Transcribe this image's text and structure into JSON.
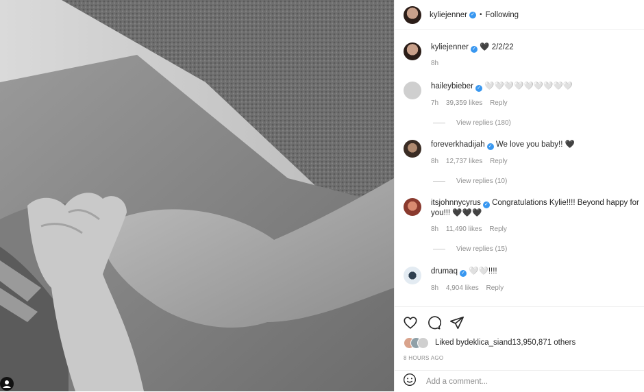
{
  "header": {
    "username": "kyliejenner",
    "separator": "•",
    "follow_status": "Following"
  },
  "caption": {
    "username": "kyliejenner",
    "text": "🖤 2/2/22",
    "time": "8h"
  },
  "comments": [
    {
      "username": "haileybieber",
      "text": "🤍🤍🤍🤍🤍🤍🤍🤍🤍",
      "time": "7h",
      "likes": "39,359 likes",
      "reply": "Reply",
      "view_replies": "View replies (180)",
      "avatar_color": "#cfcfcf"
    },
    {
      "username": "foreverkhadijah",
      "text": "We love you baby!! 🖤",
      "time": "8h",
      "likes": "12,737 likes",
      "reply": "Reply",
      "view_replies": "View replies (10)",
      "avatar_color": "#5a4a3e"
    },
    {
      "username": "itsjohnnycyrus",
      "text": "Congratulations Kylie!!!! Beyond happy for you!!! 🖤🖤🖤",
      "time": "8h",
      "likes": "11,490 likes",
      "reply": "Reply",
      "view_replies": "View replies (15)",
      "avatar_color": "#b24a3a"
    },
    {
      "username": "drumaq",
      "text": "🤍🤍!!!!",
      "time": "8h",
      "likes": "4,904 likes",
      "reply": "Reply",
      "avatar_color": "#dde6ef"
    }
  ],
  "likes_summary": {
    "prefix": "Liked by ",
    "user": "deklica_si",
    "middle": " and ",
    "count": "13,950,871 others"
  },
  "timestamp": "8 HOURS AGO",
  "add_comment": {
    "placeholder": "Add a comment..."
  },
  "colors": {
    "verified": "#3897f0",
    "muted": "#8e8e8e",
    "text": "#262626",
    "border": "#efefef"
  },
  "icons": [
    "heart-icon",
    "comment-icon",
    "share-icon",
    "emoji-icon",
    "verified-badge-icon",
    "tag-people-icon"
  ]
}
